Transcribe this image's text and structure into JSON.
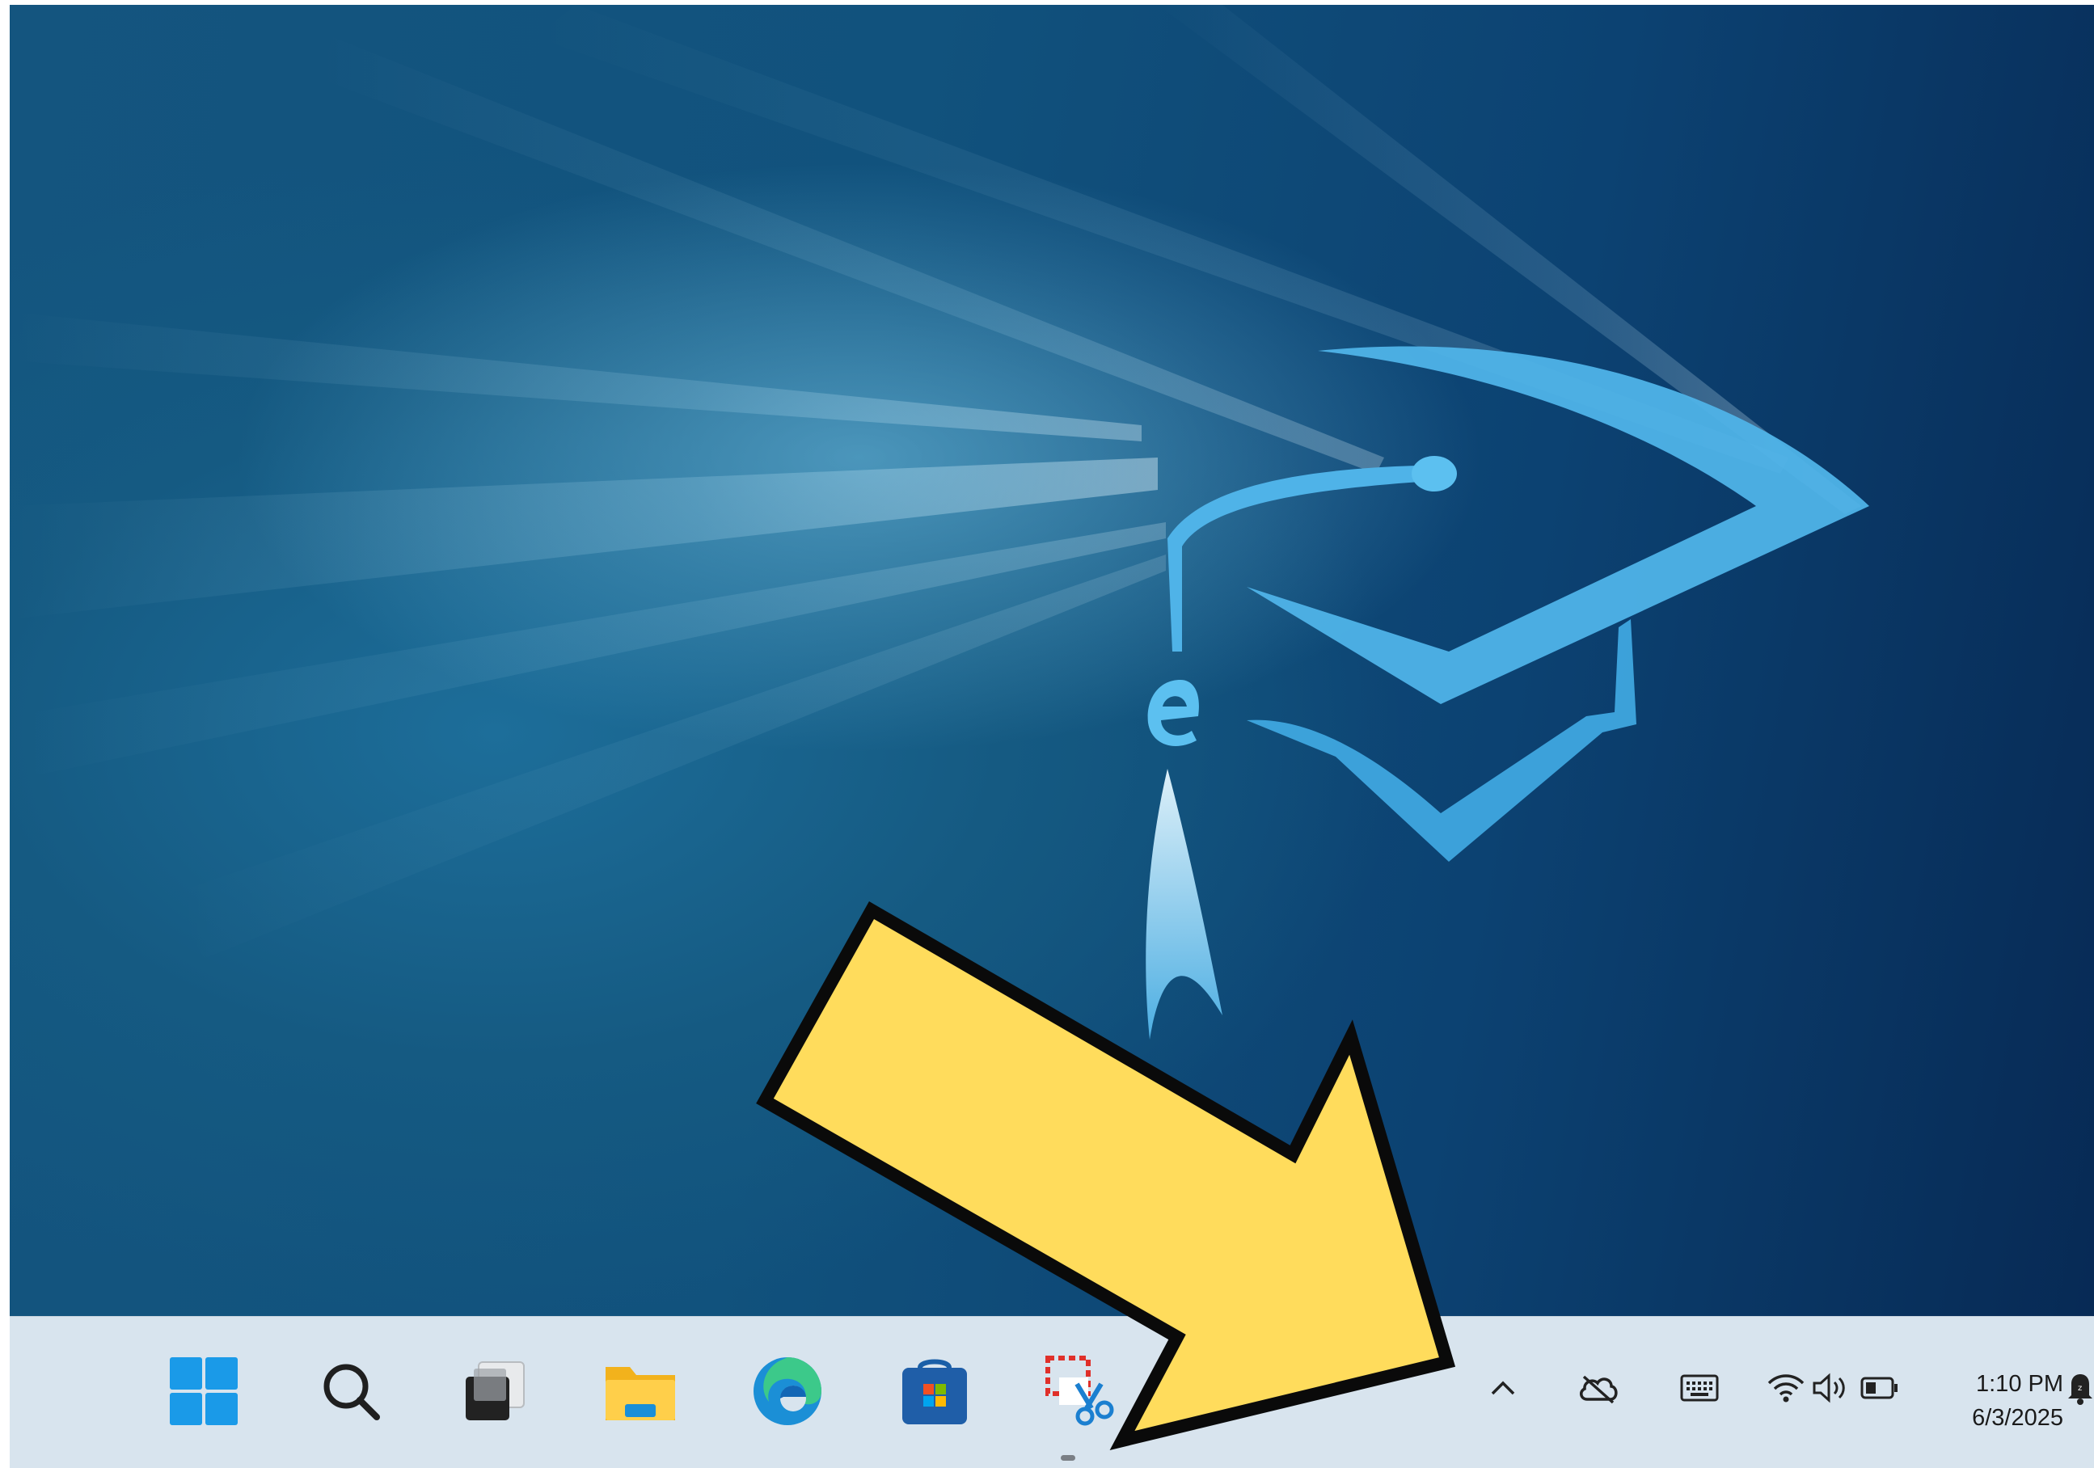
{
  "taskbar": {
    "pinned_apps": [
      {
        "name": "Start",
        "icon": "windows-start-icon"
      },
      {
        "name": "Search",
        "icon": "search-icon"
      },
      {
        "name": "Task View",
        "icon": "task-view-icon"
      },
      {
        "name": "File Explorer",
        "icon": "folder-icon"
      },
      {
        "name": "Microsoft Edge",
        "icon": "edge-icon"
      },
      {
        "name": "Microsoft Store",
        "icon": "store-icon"
      },
      {
        "name": "Snipping Tool",
        "icon": "snipping-tool-icon"
      }
    ],
    "tray": {
      "icons": [
        "chevron-up-icon",
        "onedrive-offline-icon",
        "keyboard-icon",
        "wifi-icon",
        "volume-icon",
        "battery-icon",
        "notification-bell-icon"
      ]
    },
    "clock": {
      "time": "1:10 PM",
      "date": "6/3/2025"
    }
  },
  "colors": {
    "taskbar_bg": "#d8e4ee",
    "arrow_fill": "#ffdc5c",
    "wallpaper_accent": "#4fb3e8"
  }
}
